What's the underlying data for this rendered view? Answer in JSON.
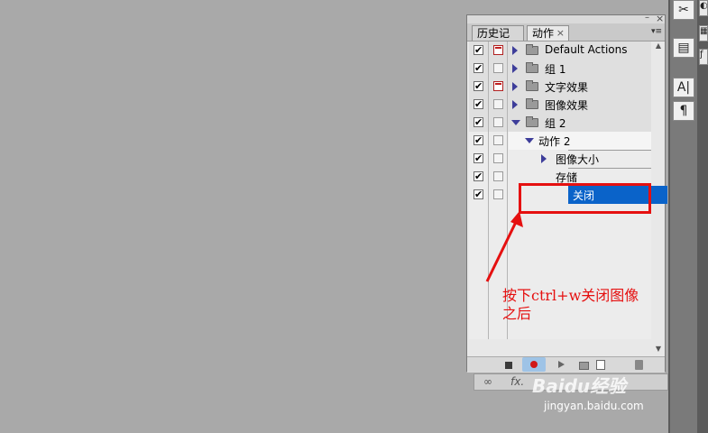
{
  "panel": {
    "tabs": [
      {
        "label": "历史记录"
      },
      {
        "label": "动作",
        "close": "×"
      }
    ],
    "window_controls": {
      "minimize": "–",
      "close": "×"
    },
    "menu_icon": "panel-menu-icon",
    "rows": [
      {
        "type": "set",
        "label": "Default Actions",
        "checked": true,
        "dialog": true,
        "expanded": false
      },
      {
        "type": "set",
        "label": "组 1",
        "checked": true,
        "dialog": false,
        "expanded": false
      },
      {
        "type": "set",
        "label": "文字效果",
        "checked": true,
        "dialog": true,
        "expanded": false
      },
      {
        "type": "set",
        "label": "图像效果",
        "checked": true,
        "dialog": false,
        "expanded": false
      },
      {
        "type": "set",
        "label": "组 2",
        "checked": true,
        "dialog": false,
        "expanded": true
      },
      {
        "type": "action",
        "label": "动作 2",
        "checked": true,
        "dialog": false,
        "expanded": true
      },
      {
        "type": "command",
        "label": "图像大小",
        "checked": true,
        "dialog": false,
        "expandable": true
      },
      {
        "type": "command",
        "label": "存储",
        "checked": true,
        "dialog": false,
        "expandable": false
      },
      {
        "type": "command",
        "label": "关闭",
        "checked": true,
        "dialog": false,
        "expandable": false,
        "selected": true
      }
    ],
    "check_mark": "✔",
    "bottom_buttons": [
      "stop-icon",
      "record-icon",
      "play-icon",
      "new-set-icon",
      "new-action-icon",
      "trash-icon"
    ]
  },
  "layers_bar": {
    "icons": [
      "link-icon",
      "fx-icon"
    ],
    "fx_label": "fx."
  },
  "dock": {
    "icons": [
      "tools-icon",
      "text-icon",
      "character-icon",
      "paragraph-icon"
    ],
    "char_label": "A|",
    "para_label": "¶"
  },
  "annotation": {
    "text": "按下ctrl+w关闭图像之后",
    "color": "#e51010"
  },
  "watermark": {
    "brand": "Baidu经验",
    "url": "jingyan.baidu.com"
  },
  "colors": {
    "selection": "#0a63c9",
    "record": "#d01818",
    "background": "#a9a9a9"
  }
}
